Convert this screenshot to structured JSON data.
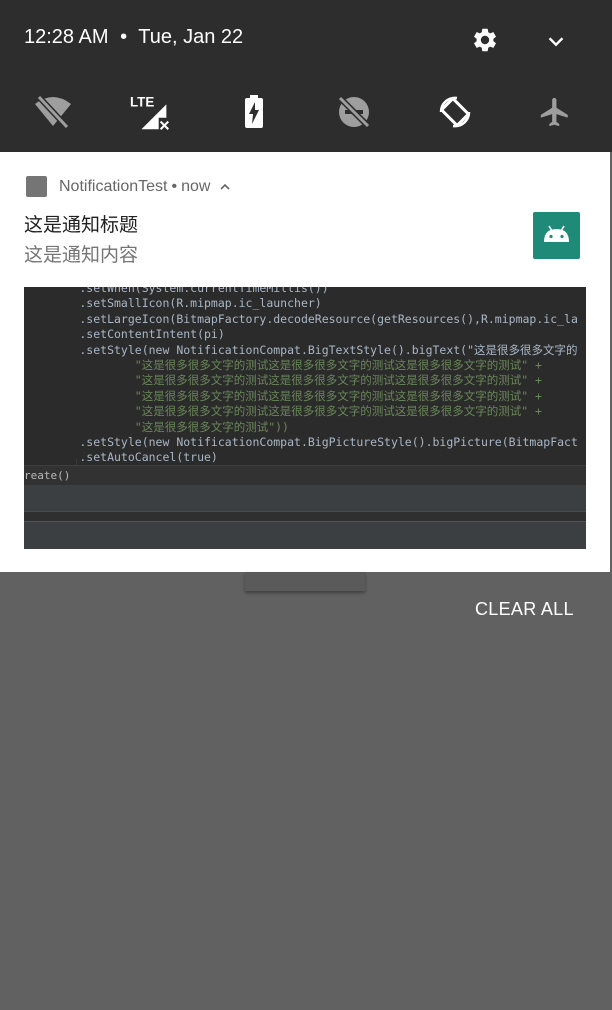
{
  "status_header": {
    "time": "12:28 AM",
    "separator": "•",
    "date": "Tue, Jan 22",
    "icons": [
      "gear-icon",
      "chevron-down-icon"
    ]
  },
  "quick_tiles": [
    {
      "name": "wifi-off-icon"
    },
    {
      "name": "lte-signal-icon",
      "text": "LTE"
    },
    {
      "name": "battery-saver-icon"
    },
    {
      "name": "dnd-icon"
    },
    {
      "name": "auto-rotate-icon"
    },
    {
      "name": "airplane-mode-icon"
    }
  ],
  "notification": {
    "app_name": "NotificationTest",
    "separator": "•",
    "time": "now",
    "title": "这是通知标题",
    "content": "这是通知内容",
    "big_picture": {
      "code_lines": [
        "        .setWhen(System.currentTimeMillis())",
        "        .setSmallIcon(R.mipmap.ic_launcher)",
        "        .setLargeIcon(BitmapFactory.decodeResource(getResources(),R.mipmap.ic_la",
        "        .setContentIntent(pi)",
        "        .setStyle(new NotificationCompat.BigTextStyle().bigText(\"这是很多很多文字的",
        "                \"这是很多很多文字的测试这是很多很多文字的测试这是很多很多文字的测试\" +",
        "                \"这是很多很多文字的测试这是很多很多文字的测试这是很多很多文字的测试\" +",
        "                \"这是很多很多文字的测试这是很多很多文字的测试这是很多很多文字的测试\" +",
        "                \"这是很多很多文字的测试这是很多很多文字的测试这是很多很多文字的测试\" +",
        "                \"这是很多很多文字的测试\"))",
        "        .setStyle(new NotificationCompat.BigPictureStyle().bigPicture(BitmapFact",
        "        .setAutoCancel(true)"
      ],
      "status_text": "reate()"
    }
  },
  "actions": {
    "clear_all": "CLEAR ALL"
  },
  "colors": {
    "header_bg": "#2d2d2d",
    "shade_bg": "#616161",
    "card_bg": "#ffffff",
    "large_icon_bg": "#1f8a78"
  }
}
